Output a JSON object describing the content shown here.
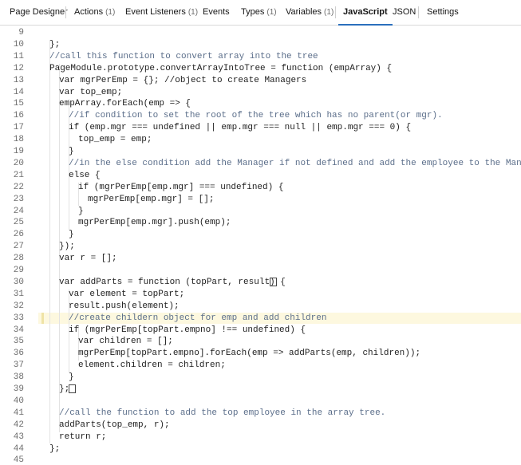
{
  "tabs": [
    {
      "label": "Page Designer",
      "count": ""
    },
    {
      "label": "Actions",
      "count": "(1)"
    },
    {
      "label": "Event Listeners",
      "count": "(1)"
    },
    {
      "label": "Events",
      "count": ""
    },
    {
      "label": "Types",
      "count": "(1)"
    },
    {
      "label": "Variables",
      "count": "(1)"
    },
    {
      "label": "JavaScript",
      "count": "",
      "active": true
    },
    {
      "label": "JSON",
      "count": ""
    },
    {
      "label": "Settings",
      "count": ""
    }
  ],
  "editor": {
    "highlighted_line": 33,
    "lines": [
      {
        "n": "9",
        "indent": 0,
        "text": ""
      },
      {
        "n": "10",
        "indent": 1,
        "text": "};"
      },
      {
        "n": "11",
        "indent": 1,
        "text": "//call this function to convert array into the tree",
        "cls": "cm"
      },
      {
        "n": "12",
        "indent": 1,
        "text": "PageModule.prototype.convertArrayIntoTree = function (empArray) {"
      },
      {
        "n": "13",
        "indent": 2,
        "text": "var mgrPerEmp = {}; //object to create Managers"
      },
      {
        "n": "14",
        "indent": 2,
        "text": "var top_emp;"
      },
      {
        "n": "15",
        "indent": 2,
        "text": "empArray.forEach(emp => {"
      },
      {
        "n": "16",
        "indent": 3,
        "text": "//if condition to set the root of the tree which has no parent(or mgr).",
        "cls": "cm"
      },
      {
        "n": "17",
        "indent": 3,
        "text": "if (emp.mgr === undefined || emp.mgr === null || emp.mgr === 0) {"
      },
      {
        "n": "18",
        "indent": 4,
        "text": "top_emp = emp;"
      },
      {
        "n": "19",
        "indent": 3,
        "text": "}"
      },
      {
        "n": "20",
        "indent": 3,
        "text": "//in the else condition add the Manager if not defined and add the employee to the Manager",
        "cls": "cm"
      },
      {
        "n": "21",
        "indent": 3,
        "text": "else {"
      },
      {
        "n": "22",
        "indent": 4,
        "text": "if (mgrPerEmp[emp.mgr] === undefined) {"
      },
      {
        "n": "23",
        "indent": 5,
        "text": "mgrPerEmp[emp.mgr] = [];"
      },
      {
        "n": "24",
        "indent": 4,
        "text": "}"
      },
      {
        "n": "25",
        "indent": 4,
        "text": "mgrPerEmp[emp.mgr].push(emp);"
      },
      {
        "n": "26",
        "indent": 3,
        "text": "}"
      },
      {
        "n": "27",
        "indent": 2,
        "text": "});"
      },
      {
        "n": "28",
        "indent": 2,
        "text": "var r = [];"
      },
      {
        "n": "29",
        "indent": 0,
        "text": ""
      },
      {
        "n": "30",
        "indent": 2,
        "text": "var addParts = function (topPart, result) {"
      },
      {
        "n": "31",
        "indent": 3,
        "text": "var element = topPart;"
      },
      {
        "n": "32",
        "indent": 3,
        "text": "result.push(element);"
      },
      {
        "n": "33",
        "indent": 3,
        "text": "//create childern object for emp and add children",
        "cls": "cm"
      },
      {
        "n": "34",
        "indent": 3,
        "text": "if (mgrPerEmp[topPart.empno] !== undefined) {"
      },
      {
        "n": "35",
        "indent": 4,
        "text": "var children = [];"
      },
      {
        "n": "36",
        "indent": 4,
        "text": "mgrPerEmp[topPart.empno].forEach(emp => addParts(emp, children));"
      },
      {
        "n": "37",
        "indent": 4,
        "text": "element.children = children;"
      },
      {
        "n": "38",
        "indent": 3,
        "text": "}"
      },
      {
        "n": "39",
        "indent": 2,
        "text": "};"
      },
      {
        "n": "40",
        "indent": 0,
        "text": ""
      },
      {
        "n": "41",
        "indent": 2,
        "text": "//call the function to add the top employee in the array tree.",
        "cls": "cm"
      },
      {
        "n": "42",
        "indent": 2,
        "text": "addParts(top_emp, r);"
      },
      {
        "n": "43",
        "indent": 2,
        "text": "return r;"
      },
      {
        "n": "44",
        "indent": 1,
        "text": "};"
      },
      {
        "n": "45",
        "indent": 0,
        "text": ""
      }
    ]
  }
}
